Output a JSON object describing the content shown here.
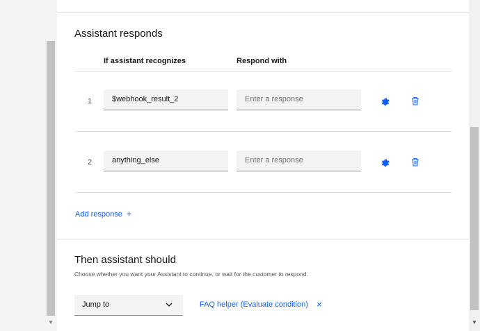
{
  "responds_section": {
    "title": "Assistant responds",
    "col_recognizes": "If assistant recognizes",
    "col_respond_with": "Respond with",
    "rows": [
      {
        "num": "1",
        "condition": "$webhook_result_2",
        "response_placeholder": "Enter a response"
      },
      {
        "num": "2",
        "condition": "anything_else",
        "response_placeholder": "Enter a response"
      }
    ],
    "add_response_label": "Add response",
    "add_response_icon": "+"
  },
  "then_section": {
    "title": "Then assistant should",
    "helper": "Choose whether you want your Assistant to continue, or wait for the customer to respond.",
    "action_selected": "Jump to",
    "jump_target": "FAQ helper (Evaluate condition)",
    "clear_icon": "×"
  },
  "icons": {
    "settings": "gear-icon",
    "delete": "trash-icon",
    "dropdown": "chevron-down-icon"
  },
  "colors": {
    "accent": "#0f62fe",
    "text": "#161616",
    "field_bg": "#f4f4f4"
  }
}
